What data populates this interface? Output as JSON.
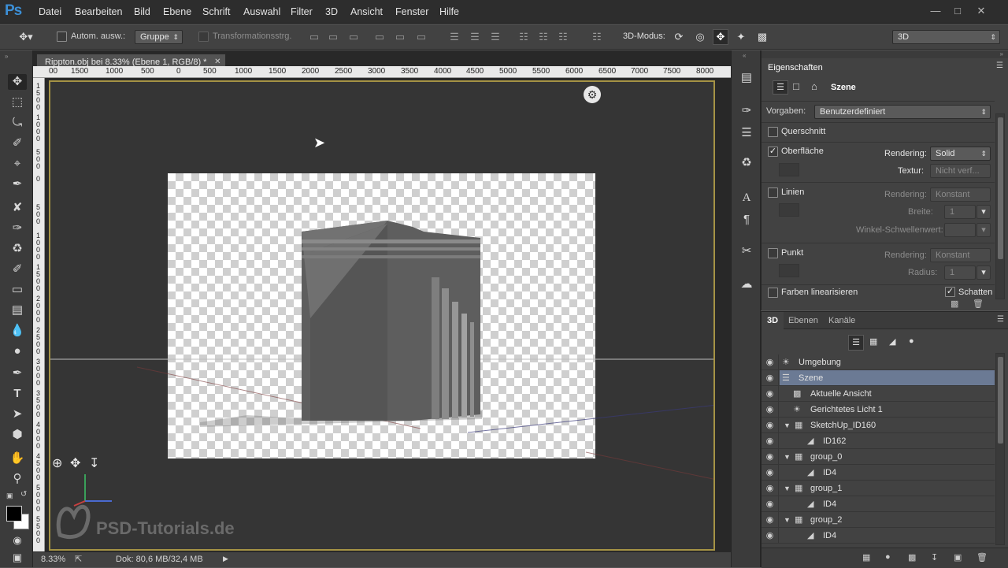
{
  "app": {
    "logo": "Ps"
  },
  "menu": [
    "Datei",
    "Bearbeiten",
    "Bild",
    "Ebene",
    "Schrift",
    "Auswahl",
    "Filter",
    "3D",
    "Ansicht",
    "Fenster",
    "Hilfe"
  ],
  "options": {
    "auto_select_label": "Autom. ausw.:",
    "auto_select_value": "Gruppe",
    "transform_label": "Transformationsstrg.",
    "mode_label": "3D-Modus:",
    "workspace": "3D"
  },
  "document": {
    "tab_title": "Rippton.obj bei 8.33% (Ebene 1, RGB/8) *",
    "ruler_ticks": [
      "00",
      "1500",
      "1000",
      "500",
      "0",
      "500",
      "1000",
      "1500",
      "2000",
      "2500",
      "3000",
      "3500",
      "4000",
      "4500",
      "5000",
      "5500",
      "6000",
      "6500",
      "7000",
      "7500",
      "8000"
    ],
    "vruler": [
      "1\n5\n0\n0",
      "1\n0\n0\n0",
      "5\n0\n0",
      "0",
      "5\n0\n0",
      "1\n0\n0\n0",
      "1\n5\n0\n0",
      "2\n0\n0\n0",
      "2\n5\n0\n0",
      "3\n0\n0\n0",
      "3\n5\n0\n0",
      "4\n0\n0\n0",
      "4\n5\n0\n0",
      "5\n0\n0\n0",
      "5\n5\n0\n0",
      "6\n0\n0\n0"
    ]
  },
  "watermark": "PSD-Tutorials.de",
  "status": {
    "zoom": "8.33%",
    "doc": "Dok: 80,6 MB/32,4 MB"
  },
  "properties": {
    "title": "Eigenschaften",
    "scene_label": "Szene",
    "presets_label": "Vorgaben:",
    "presets_value": "Benutzerdefiniert",
    "cross_section": "Querschnitt",
    "surface": "Oberfläche",
    "rendering_label": "Rendering:",
    "surface_rendering": "Solid",
    "texture_label": "Textur:",
    "texture_value": "Nicht verf...",
    "lines": "Linien",
    "lines_rendering": "Konstant",
    "width_label": "Breite:",
    "width_value": "1",
    "angle_label": "Winkel-Schwellenwert:",
    "point": "Punkt",
    "point_rendering": "Konstant",
    "radius_label": "Radius:",
    "radius_value": "1",
    "linearize": "Farben linearisieren",
    "shadows": "Schatten"
  },
  "layers": {
    "tabs": [
      "3D",
      "Ebenen",
      "Kanäle"
    ],
    "items": [
      {
        "name": "Umgebung"
      },
      {
        "name": "Szene"
      },
      {
        "name": "Aktuelle Ansicht"
      },
      {
        "name": "Gerichtetes Licht 1"
      },
      {
        "name": "SketchUp_ID160"
      },
      {
        "name": "ID162"
      },
      {
        "name": "group_0"
      },
      {
        "name": "ID4"
      },
      {
        "name": "group_1"
      },
      {
        "name": "ID4"
      },
      {
        "name": "group_2"
      },
      {
        "name": "ID4"
      }
    ]
  }
}
